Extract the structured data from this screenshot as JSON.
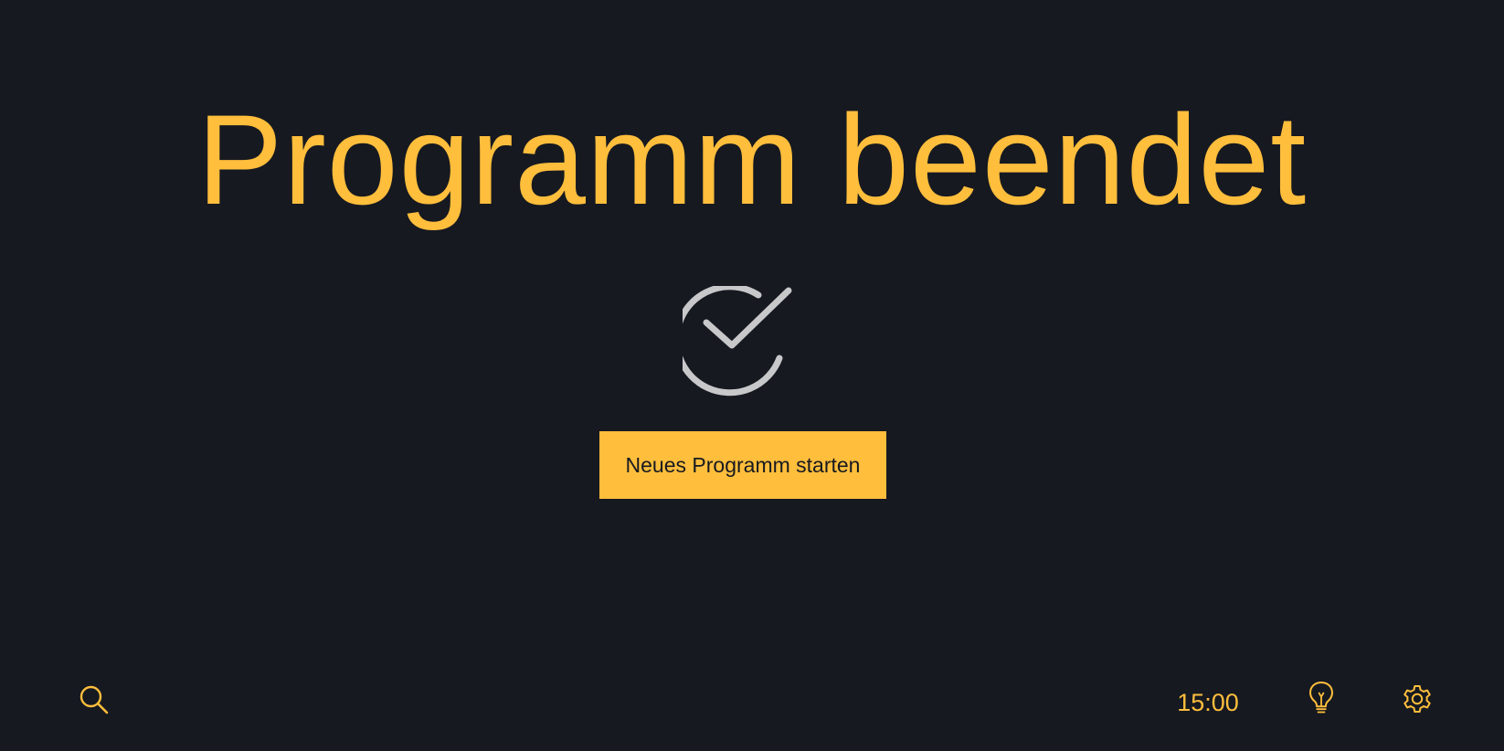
{
  "screen": {
    "title": "Programm beendet",
    "status_icon": "check-circle-icon"
  },
  "actions": {
    "start_new_program_label": "Neues Programm starten"
  },
  "bottom_bar": {
    "time": "15:00",
    "icons": [
      "search-icon",
      "lightbulb-icon",
      "gear-icon"
    ]
  },
  "colors": {
    "background": "#161920",
    "accent": "#ffbe3c",
    "icon_gray": "#c8c8ca",
    "button_text": "#161920"
  }
}
